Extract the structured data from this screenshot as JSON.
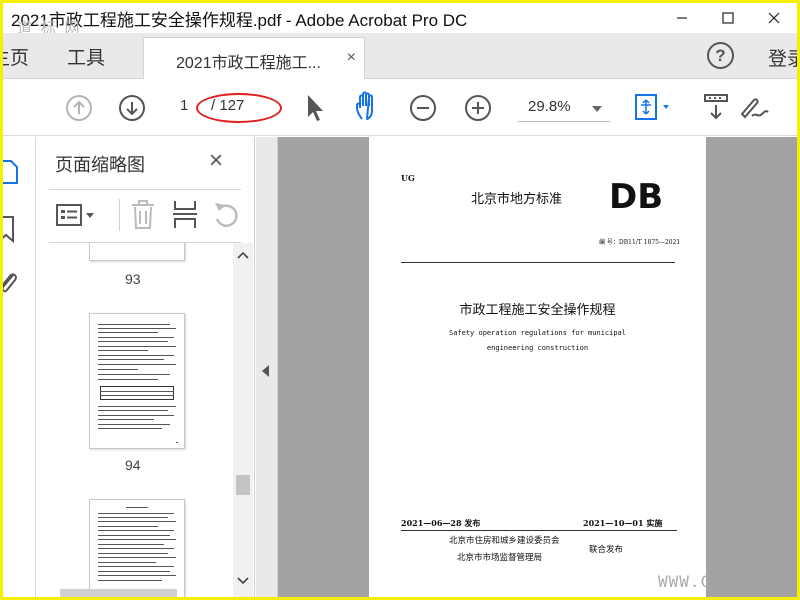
{
  "window": {
    "title": "2021市政工程施工安全操作规程.pdf - Adobe Acrobat Pro DC",
    "watermark_top": "道 标 网",
    "controls": [
      "minimize-icon",
      "maximize-icon",
      "close-icon"
    ]
  },
  "tabs": {
    "home": "主页",
    "tools": "工具",
    "document": "2021市政工程施工...",
    "document_close": "×",
    "help": "?",
    "login": "登录"
  },
  "toolbar": {
    "page_current": "1",
    "page_total": "/ 127",
    "zoom": "29.8%",
    "icons": [
      "prev-page-icon",
      "next-page-icon",
      "select-cursor-icon",
      "hand-tool-icon",
      "zoom-out-icon",
      "zoom-in-icon",
      "fit-page-icon",
      "scroll-mode-icon",
      "sign-icon"
    ]
  },
  "panel": {
    "title": "页面缩略图",
    "close": "×",
    "thumbnails": [
      {
        "page": "93"
      },
      {
        "page": "94"
      },
      {
        "page": ""
      }
    ]
  },
  "document": {
    "ug": "UG",
    "standard": "北京市地方标准",
    "db": "DB",
    "code": "编 号：DB11/T 1875—2021",
    "title_cn": "市政工程施工安全操作规程",
    "title_en_1": "Safety operation regulations for municipal",
    "title_en_2": "engineering construction",
    "publish_date": "2021—06—28 发布",
    "implement_date": "2021—10—01 实施",
    "issuer_1": "北京市住房和城乡建设委员会",
    "issuer_2": "北京市市场监督管理局",
    "joint": "联合发布"
  },
  "watermark_bottom": "WWW.C",
  "colors": {
    "frame": "#f5f000",
    "annotation": "#e02020",
    "accent": "#1473e6"
  }
}
